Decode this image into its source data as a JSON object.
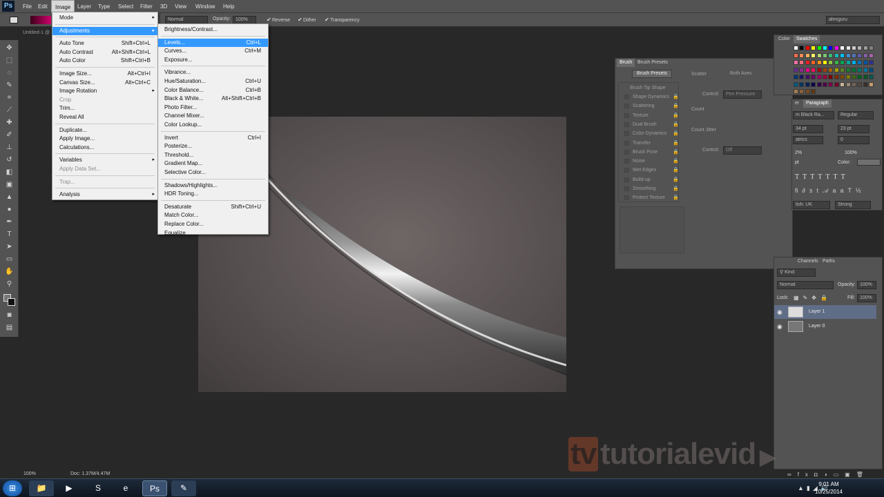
{
  "app": {
    "logo": "Ps"
  },
  "menubar": [
    "File",
    "Edit",
    "Image",
    "Layer",
    "Type",
    "Select",
    "Filter",
    "3D",
    "View",
    "Window",
    "Help"
  ],
  "options": {
    "mode_value": "Normal",
    "opacity_label": "Opacity:",
    "opacity_value": "100%",
    "reverse_label": "Reverse",
    "dither_label": "Dither",
    "transparency_label": "Transparency",
    "workspace_value": "alexguru"
  },
  "document": {
    "tab_title": "Untitled-1 @"
  },
  "status": {
    "zoom": "100%",
    "doc_info": "Doc: 1.37M/4.47M"
  },
  "image_menu": [
    {
      "label": "Mode",
      "shortcut": "",
      "submenu": true
    },
    {
      "sep": true
    },
    {
      "label": "Adjustments",
      "shortcut": "",
      "submenu": true,
      "highlight": true
    },
    {
      "sep": true
    },
    {
      "label": "Auto Tone",
      "shortcut": "Shift+Ctrl+L"
    },
    {
      "label": "Auto Contrast",
      "shortcut": "Alt+Shift+Ctrl+L"
    },
    {
      "label": "Auto Color",
      "shortcut": "Shift+Ctrl+B"
    },
    {
      "sep": true
    },
    {
      "label": "Image Size...",
      "shortcut": "Alt+Ctrl+I"
    },
    {
      "label": "Canvas Size...",
      "shortcut": "Alt+Ctrl+C"
    },
    {
      "label": "Image Rotation",
      "shortcut": "",
      "submenu": true
    },
    {
      "label": "Crop",
      "shortcut": "",
      "disabled": true
    },
    {
      "label": "Trim...",
      "shortcut": ""
    },
    {
      "label": "Reveal All",
      "shortcut": ""
    },
    {
      "sep": true
    },
    {
      "label": "Duplicate...",
      "shortcut": ""
    },
    {
      "label": "Apply Image...",
      "shortcut": ""
    },
    {
      "label": "Calculations...",
      "shortcut": ""
    },
    {
      "sep": true
    },
    {
      "label": "Variables",
      "shortcut": "",
      "submenu": true
    },
    {
      "label": "Apply Data Set...",
      "shortcut": "",
      "disabled": true
    },
    {
      "sep": true
    },
    {
      "label": "Trap...",
      "shortcut": "",
      "disabled": true
    },
    {
      "sep": true
    },
    {
      "label": "Analysis",
      "shortcut": "",
      "submenu": true
    }
  ],
  "adjustments_menu": [
    {
      "label": "Brightness/Contrast...",
      "shortcut": ""
    },
    {
      "sep": true
    },
    {
      "label": "Levels...",
      "shortcut": "Ctrl+L",
      "highlight": true
    },
    {
      "label": "Curves...",
      "shortcut": "Ctrl+M"
    },
    {
      "label": "Exposure...",
      "shortcut": ""
    },
    {
      "sep": true
    },
    {
      "label": "Vibrance...",
      "shortcut": ""
    },
    {
      "label": "Hue/Saturation...",
      "shortcut": "Ctrl+U"
    },
    {
      "label": "Color Balance...",
      "shortcut": "Ctrl+B"
    },
    {
      "label": "Black & White...",
      "shortcut": "Alt+Shift+Ctrl+B"
    },
    {
      "label": "Photo Filter...",
      "shortcut": ""
    },
    {
      "label": "Channel Mixer...",
      "shortcut": ""
    },
    {
      "label": "Color Lookup...",
      "shortcut": ""
    },
    {
      "sep": true
    },
    {
      "label": "Invert",
      "shortcut": "Ctrl+I"
    },
    {
      "label": "Posterize...",
      "shortcut": ""
    },
    {
      "label": "Threshold...",
      "shortcut": ""
    },
    {
      "label": "Gradient Map...",
      "shortcut": ""
    },
    {
      "label": "Selective Color...",
      "shortcut": ""
    },
    {
      "sep": true
    },
    {
      "label": "Shadows/Highlights...",
      "shortcut": ""
    },
    {
      "label": "HDR Toning...",
      "shortcut": ""
    },
    {
      "sep": true
    },
    {
      "label": "Desaturate",
      "shortcut": "Shift+Ctrl+U"
    },
    {
      "label": "Match Color...",
      "shortcut": ""
    },
    {
      "label": "Replace Color...",
      "shortcut": ""
    },
    {
      "label": "Equalize",
      "shortcut": ""
    }
  ],
  "brush_panel": {
    "tabs": [
      "Brush",
      "Brush Presets"
    ],
    "presets_button": "Brush Presets",
    "tip_shape": "Brush Tip Shape",
    "options": [
      "Shape Dynamics",
      "Scattering",
      "Texture",
      "Dual Brush",
      "Color Dynamics",
      "Transfer",
      "Brush Pose",
      "Noise",
      "Wet Edges",
      "Build-up",
      "Smoothing",
      "Protect Texture"
    ],
    "scatter": "Scatter",
    "both_axes": "Both Axes",
    "control": "Control:",
    "pen_pressure": "Pen Pressure",
    "count": "Count",
    "count_jitter": "Count Jitter",
    "off": "Off"
  },
  "color_panel": {
    "tabs": [
      "Color",
      "Swatches"
    ]
  },
  "swatch_colors": [
    "#ffffff",
    "#000000",
    "#ff0000",
    "#ffff00",
    "#00ff00",
    "#00ffff",
    "#0000ff",
    "#ff00ff",
    "#ffffff",
    "#e6e6e6",
    "#cccccc",
    "#b3b3b3",
    "#999999",
    "#808080",
    "#f26c4f",
    "#f68e56",
    "#fbaf5d",
    "#fff568",
    "#acd373",
    "#7cc576",
    "#3bb878",
    "#1abbb4",
    "#00bff3",
    "#448ccb",
    "#5574b9",
    "#605ca8",
    "#855fa8",
    "#a763a8",
    "#f06ea9",
    "#f26d7d",
    "#ed1c24",
    "#f26522",
    "#f7941d",
    "#fff200",
    "#8dc63f",
    "#39b54a",
    "#00a651",
    "#00a99d",
    "#00aeef",
    "#0072bc",
    "#0054a6",
    "#2e3192",
    "#662d91",
    "#92278f",
    "#ec008c",
    "#ed145b",
    "#9e0b0f",
    "#a0410d",
    "#a36209",
    "#aba000",
    "#598527",
    "#197b30",
    "#007236",
    "#00746b",
    "#0076a3",
    "#004b80",
    "#003471",
    "#1b1464",
    "#440e62",
    "#630460",
    "#9e005d",
    "#9e0039",
    "#790000",
    "#7b2e00",
    "#7d4900",
    "#827b00",
    "#406618",
    "#005e20",
    "#005826",
    "#005952",
    "#005b7f",
    "#003663",
    "#002157",
    "#0d004c",
    "#32004b",
    "#4b0049",
    "#7b0046",
    "#7a0026",
    "#c7b299",
    "#998675",
    "#736357",
    "#534741",
    "#37302d",
    "#c69c6d",
    "#a67c52",
    "#8c6239",
    "#754c24",
    "#603913"
  ],
  "character_panel": {
    "tabs": [
      "er",
      "Paragraph"
    ],
    "font": "m Black Ra...",
    "style": "Regular",
    "size": "34 pt",
    "leading": "23 pt",
    "kerning": "atrics",
    "tracking": "0",
    "scale_v": "2%",
    "scale_h": "100%",
    "baseline": "pt",
    "color_label": "Color:",
    "lang": "lish: UK",
    "aa": "Strong"
  },
  "layers_panel": {
    "tabs": [
      "Channels",
      "Paths"
    ],
    "kind": "Kind",
    "blend": "Normal",
    "opacity_label": "Opacity:",
    "opacity_value": "100%",
    "lock_label": "Lock:",
    "fill_label": "Fill:",
    "fill_value": "100%",
    "layers": [
      {
        "name": "Layer 1",
        "selected": true
      },
      {
        "name": "Layer 0",
        "selected": false
      }
    ]
  },
  "watermark": {
    "badge": "tv",
    "text": "tutorialevid"
  },
  "clock": {
    "time": "9:01 AM",
    "date": "10/25/2014"
  },
  "taskbar_icons": [
    "start-orb",
    "explorer",
    "media-player",
    "skype",
    "internet-explorer",
    "photoshop",
    "paint"
  ]
}
